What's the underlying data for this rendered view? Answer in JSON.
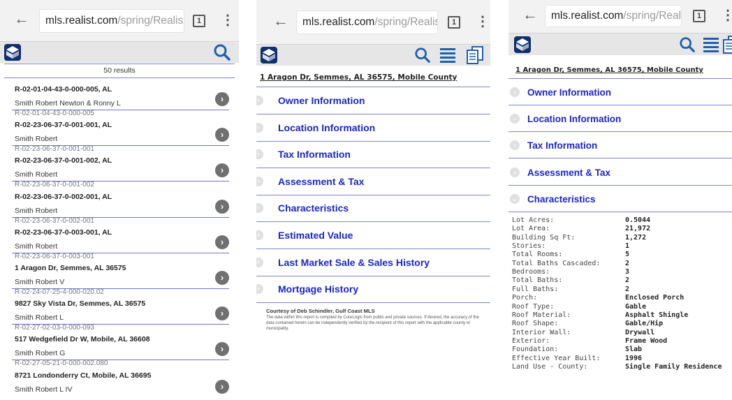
{
  "browser": {
    "url_host": "mls.realist.com",
    "url_path": "/spring/Realist",
    "tab_count": "1"
  },
  "screen1": {
    "results_count": "50 results",
    "results": [
      {
        "title": "R-02-01-04-43-0-000-005, AL",
        "owner": "Smith Robert Newton & Ronny L",
        "parcel": "R-02-01-04-43-0-000-005"
      },
      {
        "title": "R-02-23-06-37-0-001-001, AL",
        "owner": "Smith Robert",
        "parcel": "R-02-23-06-37-0-001-001"
      },
      {
        "title": "R-02-23-06-37-0-001-002, AL",
        "owner": "Smith Robert",
        "parcel": "R-02-23-06-37-0-001-002"
      },
      {
        "title": "R-02-23-06-37-0-002-001, AL",
        "owner": "Smith Robert",
        "parcel": "R-02-23-06-37-0-002-001"
      },
      {
        "title": "R-02-23-06-37-0-003-001, AL",
        "owner": "Smith Robert",
        "parcel": "R-02-23-06-37-0-003-001"
      },
      {
        "title": "1 Aragon Dr, Semmes, AL 36575",
        "owner": "Smith Robert V",
        "parcel": "R-02-24-07-25-4-000-020.02"
      },
      {
        "title": "9827 Sky Vista Dr, Semmes, AL 36575",
        "owner": "Smith Robert L",
        "parcel": "R-02-27-02-03-0-000-093"
      },
      {
        "title": "517 Wedgefield Dr W, Mobile, AL 36608",
        "owner": "Smith Robert G",
        "parcel": "R-02-27-05-21-0-000-002.080"
      },
      {
        "title": "8721 Londonderry Ct, Mobile, AL 36695",
        "owner": "Smith Robert L IV",
        "parcel": ""
      }
    ]
  },
  "screen2": {
    "address": "1 Aragon Dr, Semmes, AL 36575, Mobile County",
    "sections": [
      {
        "label": "Owner Information"
      },
      {
        "label": "Location Information"
      },
      {
        "label": "Tax Information"
      },
      {
        "label": "Assessment & Tax"
      },
      {
        "label": "Characteristics"
      },
      {
        "label": "Estimated Value"
      },
      {
        "label": "Last Market Sale & Sales History"
      },
      {
        "label": "Mortgage History"
      }
    ],
    "courtesy_title": "Courtesy of Deb Schindler, Gulf Coast MLS",
    "courtesy_text": "The data within this report is compiled by CoreLogic from public and private sources. If desired, the accuracy of the data contained herein can be independently verified by the recipient of this report with the applicable county or municipality."
  },
  "screen3": {
    "address": "1 Aragon Dr, Semmes, AL 36575, Mobile County",
    "sections": [
      {
        "label": "Owner Information"
      },
      {
        "label": "Location Information"
      },
      {
        "label": "Tax Information"
      },
      {
        "label": "Assessment & Tax"
      },
      {
        "label": "Characteristics"
      }
    ],
    "characteristics": [
      {
        "label": "Lot Acres:",
        "value": "0.5044"
      },
      {
        "label": "Lot Area:",
        "value": "21,972"
      },
      {
        "label": "Building Sq Ft:",
        "value": "1,272"
      },
      {
        "label": "Stories:",
        "value": "1"
      },
      {
        "label": "Total Rooms:",
        "value": "5"
      },
      {
        "label": "Total Baths Cascaded:",
        "value": "2"
      },
      {
        "label": "Bedrooms:",
        "value": "3"
      },
      {
        "label": "Total Baths:",
        "value": "2"
      },
      {
        "label": "Full Baths:",
        "value": "2"
      },
      {
        "label": "Porch:",
        "value": "Enclosed Porch"
      },
      {
        "label": "Roof Type:",
        "value": "Gable"
      },
      {
        "label": "Roof Material:",
        "value": "Asphalt Shingle"
      },
      {
        "label": "Roof Shape:",
        "value": "Gable/Hip"
      },
      {
        "label": "Interior Wall:",
        "value": "Drywall"
      },
      {
        "label": "Exterior:",
        "value": "Frame Wood"
      },
      {
        "label": "Foundation:",
        "value": "Slab"
      },
      {
        "label": "Effective Year Built:",
        "value": "1996"
      },
      {
        "label": "Land Use - County:",
        "value": "Single Family Residence"
      }
    ]
  },
  "icons": {
    "back": "back-arrow-icon",
    "menu": "more-vert-icon",
    "logo": "realist-logo-icon",
    "search": "search-icon",
    "list": "list-view-icon",
    "report": "report-icon",
    "chevron": "chevron-right-icon",
    "expand_right": "arrow-right-circle-icon",
    "expand_down": "arrow-down-circle-icon"
  },
  "colors": {
    "link_blue": "#1a26c4",
    "logo_navy": "#0f2f6e",
    "icon_blue": "#1e5fae",
    "divider": "#7c86c8"
  }
}
